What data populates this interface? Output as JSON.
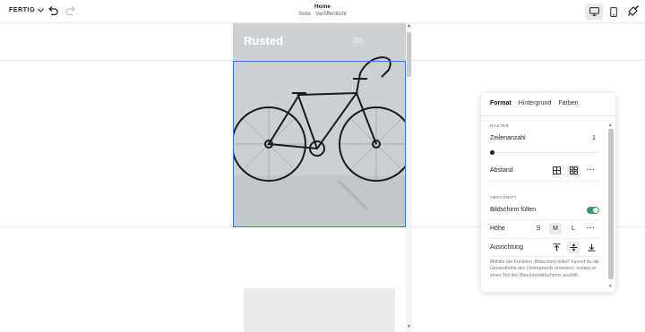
{
  "topbar": {
    "done_label": "FERTIG",
    "page_title": "Home",
    "page_status": "Seite · Veröffentlicht"
  },
  "site": {
    "title": "Rusted",
    "cart": "(0)"
  },
  "panel": {
    "tabs": [
      {
        "label": "Format",
        "active": true
      },
      {
        "label": "Hintergrund",
        "active": false
      },
      {
        "label": "Farben",
        "active": false
      }
    ],
    "grid_section": "RASTER",
    "rows_label": "Zeilenanzahl",
    "rows_value": "1",
    "spacing_label": "Abstand",
    "section_heading": "ABSCHNITT",
    "fill_screen_label": "Bildschirm füllen",
    "fill_screen_on": true,
    "height_label": "Höhe",
    "height_options": [
      "S",
      "M",
      "L"
    ],
    "height_selected": "M",
    "alignment_label": "Ausrichtung",
    "help_text": "Mithilfe der Funktion „Bildschirm füllen\" kannst du die Gesamthöhe des Hintergrunds erweitern, sodass er einen Teil des Benutzerbildschirms ausfüllt."
  },
  "colors": {
    "accent": "#3b79d8",
    "toggle_on": "#3a9f64"
  },
  "icons": [
    "chevron-down-icon",
    "undo-icon",
    "redo-icon",
    "desktop-icon",
    "mobile-icon",
    "paintbrush-icon",
    "grid-icon",
    "dots-icon",
    "align-top-icon",
    "align-middle-icon",
    "align-bottom-icon"
  ]
}
